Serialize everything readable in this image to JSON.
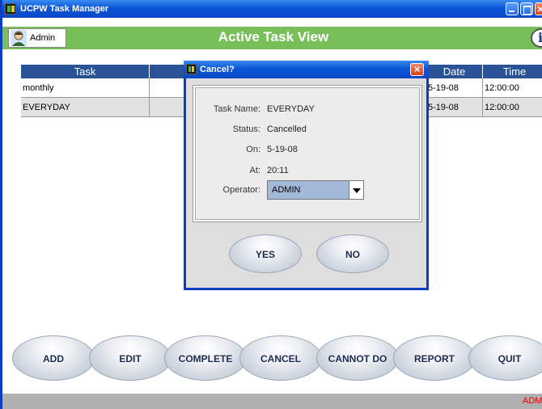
{
  "window": {
    "title": "UCPW Task Manager"
  },
  "header": {
    "user": "Admin",
    "title": "Active Task View",
    "info_glyph": "i"
  },
  "table": {
    "columns": [
      {
        "label": "Task"
      },
      {
        "label": ""
      },
      {
        "label": "Date"
      },
      {
        "label": "Time"
      }
    ],
    "rows": [
      {
        "task": "monthly",
        "date": "5-19-08",
        "time": "12:00:00"
      },
      {
        "task": "EVERYDAY",
        "date": "5-19-08",
        "time": "12:00:00"
      }
    ]
  },
  "dialog": {
    "title": "Cancel?",
    "close_glyph": "×",
    "fields": {
      "task_name_label": "Task Name:",
      "task_name": "EVERYDAY",
      "status_label": "Status:",
      "status": "Cancelled",
      "on_label": "On:",
      "on": "5-19-08",
      "at_label": "At:",
      "at": "20:11",
      "operator_label": "Operator:",
      "operator": "ADMIN"
    },
    "yes_label": "YES",
    "no_label": "NO"
  },
  "toolbar": {
    "add": "ADD",
    "edit": "EDIT",
    "complete": "COMPLETE",
    "cancel": "CANCEL",
    "cannot_do": "CANNOT DO",
    "report": "REPORT",
    "quit": "QUIT"
  },
  "status_bar": {
    "text": "ADM"
  },
  "colors": {
    "titlebar": "#0b56d8",
    "header_green": "#79bf59",
    "table_header": "#2a5296",
    "status_red": "#e00000",
    "operator_select": "#a3b9d9"
  }
}
